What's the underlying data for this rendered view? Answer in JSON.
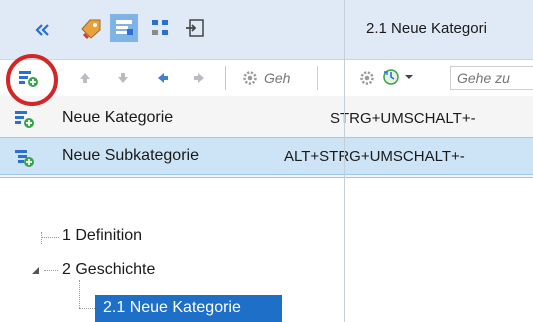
{
  "toolbar": {
    "collapse_icon": "double-chevron-left",
    "tab_title": "2.1 Neue Kategori",
    "tools": [
      "tag-icon",
      "new-document-icon",
      "structure-icon",
      "import-icon"
    ]
  },
  "toolbar2": {
    "left_search_placeholder": "Geh",
    "right_search_placeholder": "Gehe zu",
    "icons": [
      "new-category-icon",
      "arrow-up-icon",
      "arrow-down-icon",
      "arrow-left-icon",
      "arrow-right-icon",
      "settings-icon",
      "settings-icon",
      "history-icon"
    ]
  },
  "menu": {
    "items": [
      {
        "label": "Neue Kategorie",
        "shortcut": "STRG+UMSCHALT+-"
      },
      {
        "label": "Neue Subkategorie",
        "shortcut": "ALT+STRG+UMSCHALT+-"
      }
    ]
  },
  "tree": {
    "items": [
      {
        "label": "1 Definition"
      },
      {
        "label": "2 Geschichte"
      },
      {
        "label": "2.1 Neue Kategorie"
      }
    ]
  },
  "colors": {
    "toolbar_bg": "#dfeaf6",
    "menu_highlight": "#cde4f7",
    "tree_selection": "#1e6fc7",
    "annotation_red": "#d32626"
  }
}
